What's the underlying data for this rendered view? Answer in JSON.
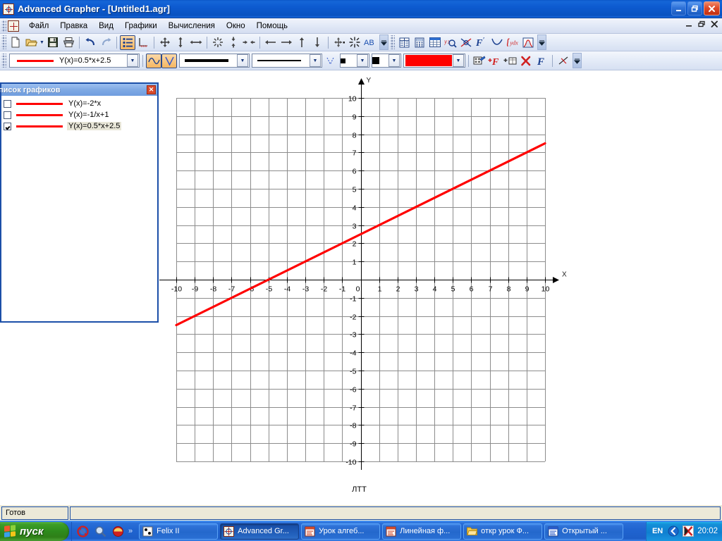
{
  "window": {
    "title": "Advanced Grapher - [Untitled1.agr]",
    "icon": "grapher-icon",
    "buttons": {
      "minimize": "_",
      "restore": "❐",
      "close": "✕"
    },
    "mdi_buttons": {
      "minimize": "_",
      "restore": "❐",
      "close": "✕"
    }
  },
  "menu": {
    "items": [
      {
        "label": "Файл",
        "name": "menu-file"
      },
      {
        "label": "Правка",
        "name": "menu-edit"
      },
      {
        "label": "Вид",
        "name": "menu-view"
      },
      {
        "label": "Графики",
        "name": "menu-graphs"
      },
      {
        "label": "Вычисления",
        "name": "menu-calculations"
      },
      {
        "label": "Окно",
        "name": "menu-window"
      },
      {
        "label": "Помощь",
        "name": "menu-help"
      }
    ]
  },
  "toolbar_main": {
    "icons": [
      "new-document-icon",
      "open-folder-icon",
      "save-disk-icon",
      "print-icon",
      "undo-icon",
      "redo-icon",
      "graph-list-icon",
      "axes-properties-icon",
      "move-all-icon",
      "move-vertical-icon",
      "move-horizontal-icon",
      "zoom-in-all-icon",
      "zoom-in-vertical-icon",
      "zoom-in-horizontal-icon",
      "scroll-left-icon",
      "scroll-right-icon",
      "scroll-up-icon",
      "scroll-down-icon",
      "center-origin-icon",
      "zoom-fit-icon",
      "label-ab-icon",
      "table-icon",
      "calculator-icon",
      "spreadsheet-icon",
      "find-value-icon",
      "intersection-icon",
      "derivative-icon",
      "tangent-icon",
      "integral-icon",
      "area-icon"
    ],
    "overflow": "»"
  },
  "toolbar_graph": {
    "function_combo": {
      "value": "Y(x)=0.5*x+2.5",
      "line_color": "#ff0000",
      "name": "function-selector"
    },
    "mode_buttons": [
      {
        "name": "curve-mode-button",
        "glyph": "∿",
        "active": true
      },
      {
        "name": "line-style-mode-button",
        "glyph": "V",
        "active": true
      }
    ],
    "thick_line_combo": "thick-line-style",
    "thin_line_combo": "thin-line-style",
    "marker_small": "small-marker-style",
    "marker_large": "large-marker-style",
    "color_combo": {
      "color": "#ff0000",
      "name": "graph-color-selector"
    },
    "action_icons": [
      "properties-icon",
      "add-function-icon",
      "add-table-icon",
      "delete-graph-icon",
      "edit-function-icon",
      "tangent-tool-icon"
    ]
  },
  "graph_list_panel": {
    "title": "писок графиков",
    "close_label": "✕",
    "items": [
      {
        "label": "Y(x)=-2*x",
        "checked": false,
        "color": "#ff0000",
        "selected": false
      },
      {
        "label": "Y(x)=-1/x+1",
        "checked": false,
        "color": "#ff0000",
        "selected": false
      },
      {
        "label": "Y(x)=0.5*x+2.5",
        "checked": true,
        "color": "#ff0000",
        "selected": true
      }
    ]
  },
  "chart_data": {
    "type": "line",
    "title": "",
    "caption": "ЛТТ",
    "xlabel": "X",
    "ylabel": "Y",
    "xlim": [
      -10,
      10
    ],
    "ylim": [
      -10,
      10
    ],
    "grid": true,
    "grid_step": 1,
    "x_ticks": [
      -10,
      -9,
      -8,
      -7,
      -6,
      -5,
      -4,
      -3,
      -2,
      -1,
      0,
      1,
      2,
      3,
      4,
      5,
      6,
      7,
      8,
      9,
      10
    ],
    "y_ticks": [
      -10,
      -9,
      -8,
      -7,
      -6,
      -5,
      -4,
      -3,
      -2,
      -1,
      0,
      1,
      2,
      3,
      4,
      5,
      6,
      7,
      8,
      9,
      10
    ],
    "series": [
      {
        "name": "Y(x)=0.5*x+2.5",
        "color": "#ff0000",
        "slope": 0.5,
        "intercept": 2.5,
        "x": [
          -10,
          10
        ],
        "values": [
          -2.5,
          7.5
        ]
      }
    ],
    "legend": "none"
  },
  "status_bar": {
    "message": "Готов",
    "secondary": ""
  },
  "taskbar": {
    "start_label": "пуск",
    "quick_launch": [
      {
        "name": "ql-browser-icon"
      },
      {
        "name": "ql-search-icon"
      },
      {
        "name": "ql-media-icon"
      }
    ],
    "quick_launch_more": "»",
    "tasks": [
      {
        "label": "Felix II",
        "icon": "cards-icon",
        "active": false
      },
      {
        "label": "Advanced Gr...",
        "icon": "grapher-icon",
        "active": true
      },
      {
        "label": "Урок алгеб...",
        "icon": "presentation-icon",
        "active": false
      },
      {
        "label": "Линейная ф...",
        "icon": "presentation-icon",
        "active": false
      },
      {
        "label": "откр урок Ф...",
        "icon": "folder-icon",
        "active": false
      },
      {
        "label": "Открытый ...",
        "icon": "word-doc-icon",
        "active": false
      }
    ],
    "tray": {
      "language": "EN",
      "icons": [
        "volume-icon",
        "antivirus-icon"
      ],
      "clock": "20:02"
    }
  }
}
